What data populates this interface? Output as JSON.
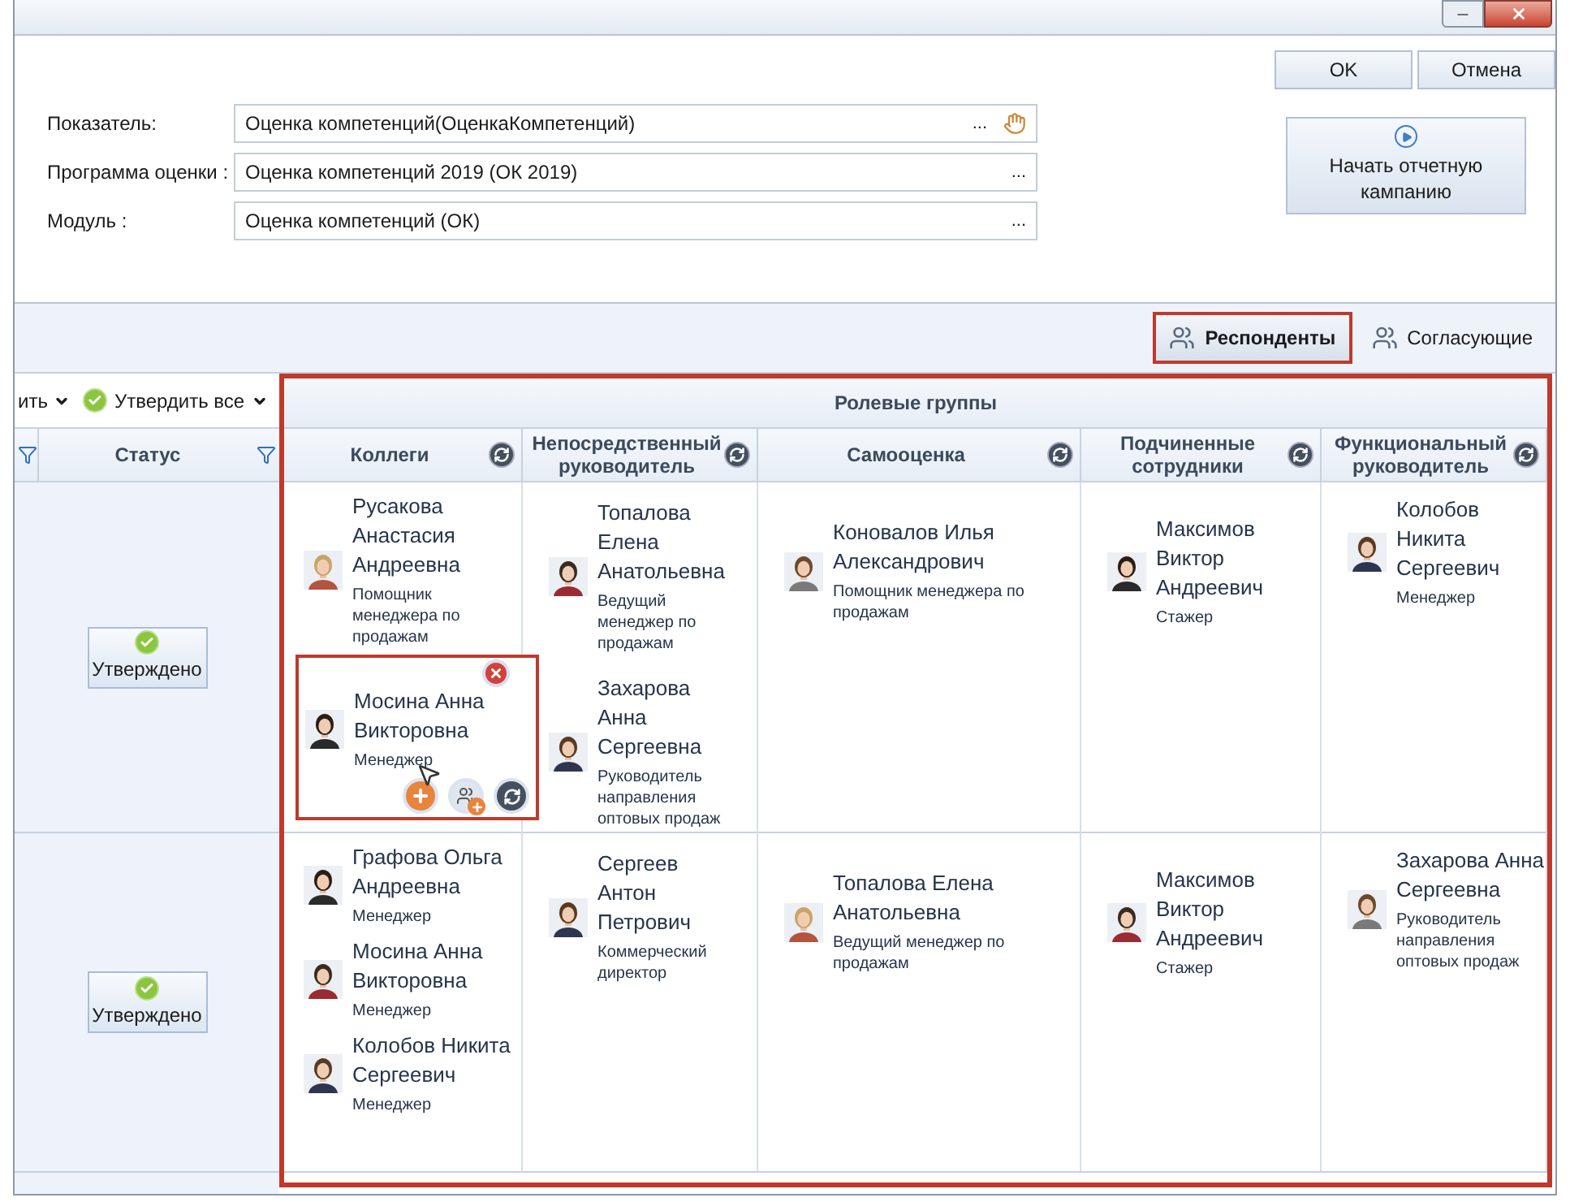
{
  "dialog_buttons": [
    "OK",
    "Отмена"
  ],
  "fields": [
    {
      "label": "Показатель:",
      "value": "Оценка компетенций(ОценкаКомпетенций)",
      "browse": "...",
      "kind": "linked"
    },
    {
      "label": "Программа оценки :",
      "value": "Оценка компетенций 2019 (ОК 2019)",
      "browse": "...",
      "kind": "plain"
    },
    {
      "label": "Модуль :",
      "value": "Оценка компетенций (ОК)",
      "browse": "...",
      "kind": "plain"
    }
  ],
  "start_button": "Начать отчетную кампанию",
  "view_tabs": [
    {
      "label": "Респонденты",
      "selected": true
    },
    {
      "label": "Согласующие",
      "selected": false
    }
  ],
  "toolbar": [
    {
      "label": "ить",
      "kind": "dropdown"
    },
    {
      "label": "Утвердить все",
      "kind": "approve"
    }
  ],
  "table": {
    "status_column": "Статус",
    "group_header": "Ролевые группы",
    "role_columns": [
      "Коллеги",
      "Непосредственный руководитель",
      "Самооценка",
      "Подчиненные сотрудники",
      "Функциональный руководитель"
    ],
    "rows": [
      {
        "status": "Утверждено",
        "cells": [
          [
            {
              "name": "Русакова Анастасия Андреевна",
              "position": "Помощник менеджера по продажам",
              "selected": false
            },
            {
              "name": "Мосина Анна Викторовна",
              "position": "Менеджер",
              "selected": true
            }
          ],
          [
            {
              "name": "Топалова Елена Анатольевна",
              "position": "Ведущий менеджер по продажам",
              "selected": false
            },
            {
              "name": "Захарова Анна Сергеевна",
              "position": "Руководитель направления оптовых продаж",
              "selected": false
            }
          ],
          [
            {
              "name": "Коновалов Илья Александрович",
              "position": "Помощник менеджера по продажам",
              "selected": false
            }
          ],
          [
            {
              "name": "Максимов Виктор Андреевич",
              "position": "Стажер",
              "selected": false
            }
          ],
          [
            {
              "name": "Колобов Никита Сергеевич",
              "position": "Менеджер",
              "selected": false
            }
          ]
        ]
      },
      {
        "status": "Утверждено",
        "cells": [
          [
            {
              "name": "Графова Ольга Андреевна",
              "position": "Менеджер",
              "selected": false
            },
            {
              "name": "Мосина Анна Викторовна",
              "position": "Менеджер",
              "selected": false
            },
            {
              "name": "Колобов Никита Сергеевич",
              "position": "Менеджер",
              "selected": false
            }
          ],
          [
            {
              "name": "Сергеев Антон Петрович",
              "position": "Коммерческий директор",
              "selected": false
            }
          ],
          [
            {
              "name": "Топалова Елена Анатольевна",
              "position": "Ведущий менеджер по продажам",
              "selected": false
            }
          ],
          [
            {
              "name": "Максимов Виктор Андреевич",
              "position": "Стажер",
              "selected": false
            }
          ],
          [
            {
              "name": "Захарова Анна Сергеевна",
              "position": "Руководитель направления оптовых продаж",
              "selected": false
            }
          ]
        ]
      }
    ]
  }
}
